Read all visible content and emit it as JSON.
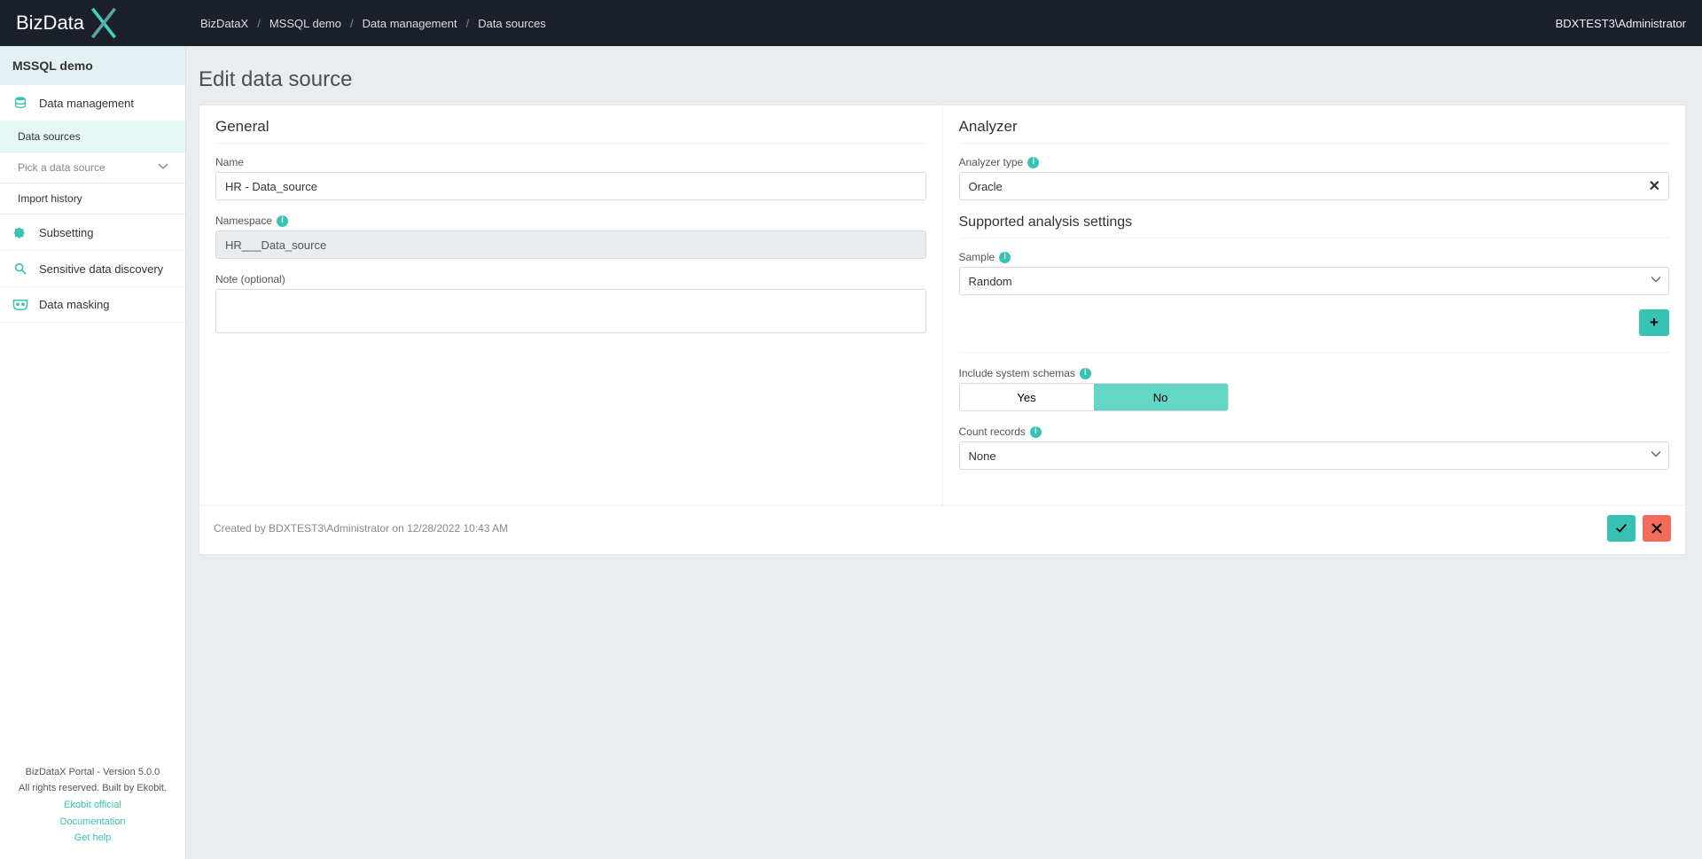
{
  "header": {
    "logo_text": "BizData",
    "breadcrumbs": [
      "BizDataX",
      "MSSQL demo",
      "Data management",
      "Data sources"
    ],
    "user": "BDXTEST3\\Administrator"
  },
  "sidebar": {
    "project": "MSSQL demo",
    "items": {
      "data_management": "Data management",
      "data_sources": "Data sources",
      "pick_source": "Pick a data source",
      "import_history": "Import history",
      "subsetting": "Subsetting",
      "sensitive": "Sensitive data discovery",
      "masking": "Data masking"
    },
    "footer": {
      "line1": "BizDataX Portal - Version 5.0.0",
      "line2": "All rights reserved. Built by Ekobit.",
      "link1": "Ekobit official",
      "link2": "Documentation",
      "link3": "Get help"
    }
  },
  "page": {
    "title": "Edit data source",
    "general": {
      "heading": "General",
      "name_label": "Name",
      "name_value": "HR - Data_source",
      "namespace_label": "Namespace",
      "namespace_value": "HR___Data_source",
      "note_label": "Note (optional)",
      "note_value": ""
    },
    "analyzer": {
      "heading": "Analyzer",
      "type_label": "Analyzer type",
      "type_value": "Oracle",
      "supported_heading": "Supported analysis settings",
      "sample_label": "Sample",
      "sample_value": "Random",
      "include_label": "Include system schemas",
      "yes": "Yes",
      "no": "No",
      "count_label": "Count records",
      "count_value": "None"
    },
    "created_text": "Created by BDXTEST3\\Administrator on 12/28/2022 10:43 AM"
  }
}
